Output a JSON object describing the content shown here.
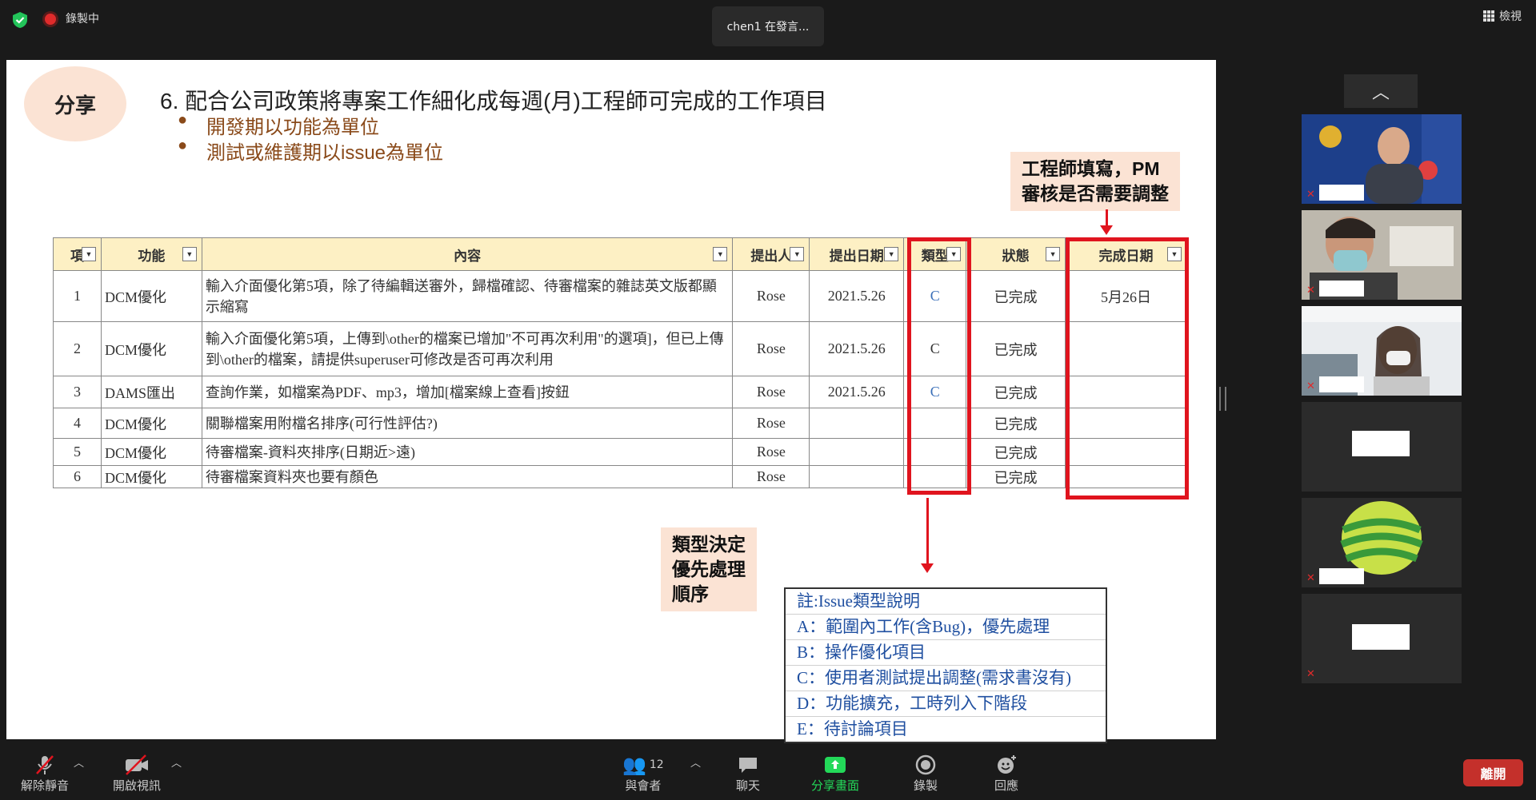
{
  "topbar": {
    "recording_label": "錄製中",
    "speaker_label": "chen1 在發言...",
    "view_label": "檢視"
  },
  "slide": {
    "badge": "分享",
    "title": "6. 配合公司政策將專案工作細化成每週(月)工程師可完成的工作項目",
    "bullets": [
      "開發期以功能為單位",
      "測試或維護期以issue為單位"
    ],
    "callout_top": [
      "工程師填寫，PM",
      "審核是否需要調整"
    ],
    "callout_left": [
      "類型決定",
      "優先處理",
      "順序"
    ],
    "table": {
      "headers": [
        "項",
        "功能",
        "內容",
        "提出人",
        "提出日期",
        "類型",
        "狀態",
        "完成日期"
      ],
      "rows": [
        {
          "no": "1",
          "feature": "DCM優化",
          "content": "輸入介面優化第5項，除了待編輯送審外，歸檔確認、待審檔案的雜誌英文版都顯示縮寫",
          "by": "Rose",
          "date": "2021.5.26",
          "type": "C",
          "status": "已完成",
          "done": "5月26日"
        },
        {
          "no": "2",
          "feature": "DCM優化",
          "content": "輸入介面優化第5項，上傳到\\other的檔案已增加\"不可再次利用\"的選項]，但已上傳到\\other的檔案，請提供superuser可修改是否可再次利用",
          "by": "Rose",
          "date": "2021.5.26",
          "type": "C",
          "status": "已完成",
          "done": ""
        },
        {
          "no": "3",
          "feature": "DAMS匯出",
          "content": "查詢作業，如檔案為PDF、mp3，增加[檔案線上查看]按鈕",
          "by": "Rose",
          "date": "2021.5.26",
          "type": "C",
          "status": "已完成",
          "done": ""
        },
        {
          "no": "4",
          "feature": "DCM優化",
          "content": "關聯檔案用附檔名排序(可行性評估?)",
          "by": "Rose",
          "date": "",
          "type": "",
          "status": "已完成",
          "done": ""
        },
        {
          "no": "5",
          "feature": "DCM優化",
          "content": "待審檔案-資料夾排序(日期近>遠)",
          "by": "Rose",
          "date": "",
          "type": "",
          "status": "已完成",
          "done": ""
        },
        {
          "no": "6",
          "feature": "DCM優化",
          "content": "待審檔案資料夾也要有顏色",
          "by": "Rose",
          "date": "",
          "type": "",
          "status": "已完成",
          "done": ""
        }
      ]
    },
    "note": [
      "註:Issue類型說明",
      "A：範圍內工作(含Bug)，優先處理",
      "B：操作優化項目",
      "C：使用者測試提出調整(需求書沒有)",
      "D：功能擴充，工時列入下階段",
      "E：待討論項目"
    ]
  },
  "toolbar": {
    "unmute": "解除靜音",
    "start_video": "開啟視訊",
    "participants": "與會者",
    "participants_count": "12",
    "chat": "聊天",
    "share": "分享畫面",
    "record": "錄製",
    "reactions": "回應",
    "leave": "離開"
  },
  "colors": {
    "accent_red": "#e0141e",
    "share_green": "#23d959",
    "leave_red": "#c4302b",
    "callout_bg": "#fbe3d4"
  }
}
